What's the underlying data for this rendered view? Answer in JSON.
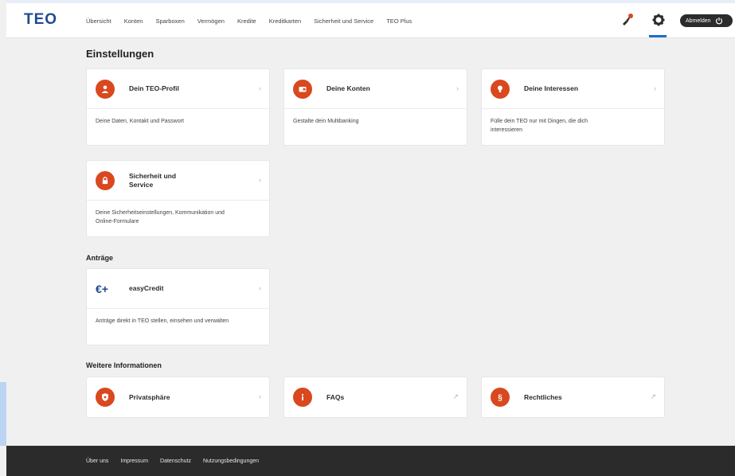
{
  "header": {
    "logo": "TEO",
    "nav": [
      "Übersicht",
      "Konten",
      "Sparboxen",
      "Vermögen",
      "Kredite",
      "Kreditkarten",
      "Sicherheit und Service",
      "TEO Plus"
    ],
    "logout_label": "Abmelden"
  },
  "main": {
    "title": "Einstellungen",
    "cards": [
      {
        "title": "Dein TEO-Profil",
        "desc": "Deine Daten, Kontakt und Passwort",
        "icon": "person-icon"
      },
      {
        "title": "Deine Konten",
        "desc": "Gestalte dein Multibanking",
        "icon": "wallet-icon"
      },
      {
        "title": "Deine Interessen",
        "desc": "Fülle dein TEO nur mit Dingen, die dich interessieren",
        "icon": "lightbulb-icon"
      },
      {
        "title": "Sicherheit und Service",
        "desc": "Deine Sicherheitseinstellungen, Kommunikation und Online-Formulare",
        "icon": "lock-icon"
      }
    ],
    "antraege": {
      "title": "Anträge",
      "card": {
        "title": "easyCredit",
        "desc": "Anträge direkt in TEO stellen, einsehen und verwalten",
        "icon": "easycredit-icon",
        "icon_text": "€+"
      }
    },
    "weitere": {
      "title": "Weitere Informationen",
      "cards": [
        {
          "title": "Privatsphäre",
          "icon": "shield-icon",
          "arrow": "›"
        },
        {
          "title": "FAQs",
          "icon": "info-icon",
          "arrow": "↗"
        },
        {
          "title": "Rechtliches",
          "icon": "paragraph-icon",
          "arrow": "↗"
        }
      ]
    }
  },
  "footer": {
    "links": [
      "Über uns",
      "Impressum",
      "Datenschutz",
      "Nutzungsbedingungen"
    ]
  },
  "colors": {
    "accent": "#d9481f",
    "brand": "#1e4a8f",
    "footer": "#2b2b2b",
    "active": "#1e6cd1"
  }
}
